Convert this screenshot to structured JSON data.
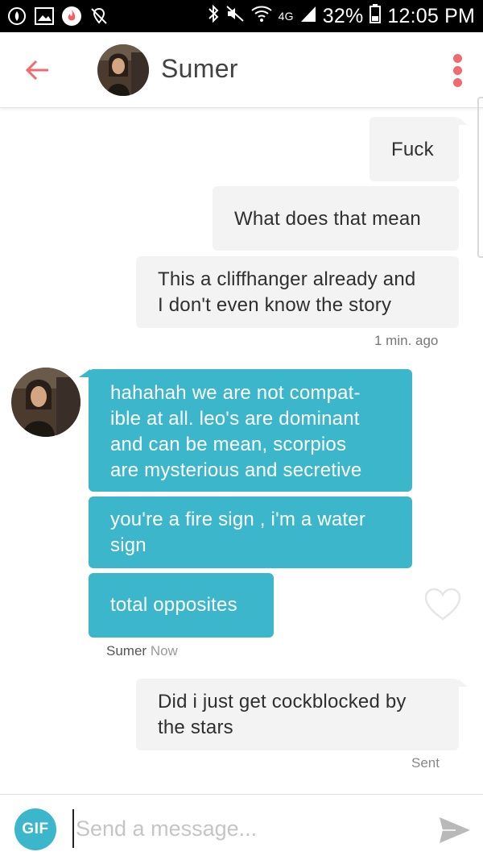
{
  "status_bar": {
    "battery": "32%",
    "time": "12:05 PM",
    "network": "4G"
  },
  "header": {
    "contact_name": "Sumer"
  },
  "messages": [
    {
      "direction": "out",
      "text_lines": [
        "Fuck"
      ]
    },
    {
      "direction": "out",
      "text_lines": [
        "What does that mean"
      ]
    },
    {
      "direction": "out",
      "text_lines": [
        "This a cliffhanger already and",
        "I don't even know the story"
      ]
    },
    {
      "direction": "in",
      "text_lines": [
        "hahahah we are not compat-",
        "ible at all. leo's are dominant",
        "and can be mean, scorpios",
        "are mysterious and secretive"
      ]
    },
    {
      "direction": "in",
      "text_lines": [
        "you're a fire sign , i'm a water",
        "sign"
      ]
    },
    {
      "direction": "in",
      "text_lines": [
        "total opposites"
      ]
    },
    {
      "direction": "out",
      "text_lines": [
        "Did i just get cockblocked by",
        "the stars"
      ]
    }
  ],
  "meta": {
    "out_timestamp": "1 min. ago",
    "in_sender": "Sumer",
    "in_timestamp": "Now",
    "sent_status": "Sent"
  },
  "composer": {
    "gif_label": "GIF",
    "placeholder": "Send a message..."
  },
  "colors": {
    "accent_teal": "#3cb6cb",
    "tinder_red": "#f06a6f",
    "outgoing_bubble": "#f3f3f3"
  },
  "icons": {
    "back": "arrow-left-icon",
    "more": "vertical-dots-icon",
    "like": "heart-outline-icon",
    "send": "paper-plane-icon"
  }
}
